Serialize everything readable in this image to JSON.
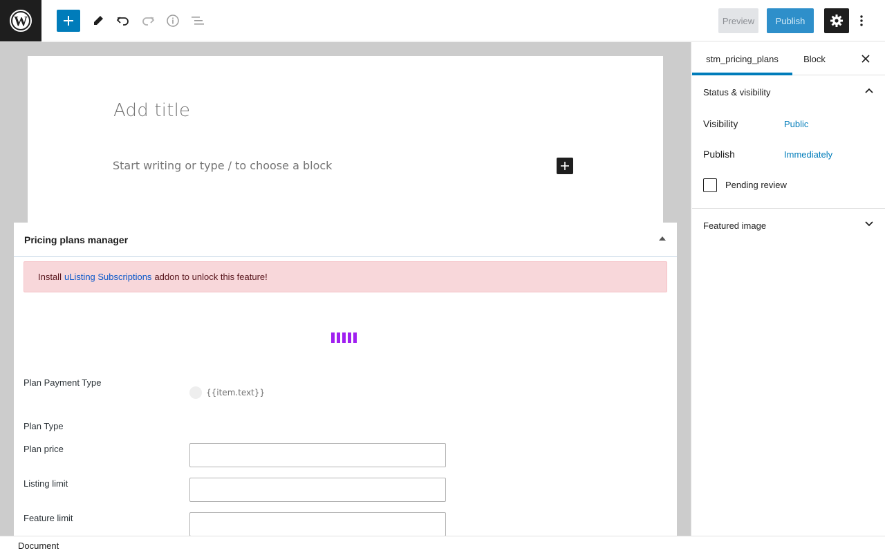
{
  "toolbar": {
    "preview_label": "Preview",
    "publish_label": "Publish"
  },
  "editor": {
    "title_placeholder": "Add title",
    "block_placeholder": "Start writing or type / to choose a block"
  },
  "metabox": {
    "title": "Pricing plans manager",
    "notice": {
      "prefix": "Install",
      "link": "uListing Subscriptions",
      "suffix": "addon to unlock this feature!"
    },
    "fields": {
      "payment_type_label": "Plan Payment Type",
      "payment_type_option": "{{item.text}}",
      "plan_type_label": "Plan Type",
      "plan_price_label": "Plan price",
      "listing_limit_label": "Listing limit",
      "feature_limit_label": "Feature limit"
    }
  },
  "sidebar": {
    "tabs": [
      "stm_pricing_plans",
      "Block"
    ],
    "active_tab": "stm_pricing_plans",
    "status_panel": {
      "title": "Status & visibility",
      "visibility_label": "Visibility",
      "visibility_value": "Public",
      "publish_label": "Publish",
      "publish_value": "Immediately",
      "pending_review_label": "Pending review"
    },
    "featured_image_title": "Featured image"
  },
  "footer": {
    "breadcrumb": "Document"
  },
  "colors": {
    "accent": "#007cba",
    "dark": "#1e1e1e",
    "notice_bg": "#f8d7da",
    "spinner": "#a020f0"
  }
}
